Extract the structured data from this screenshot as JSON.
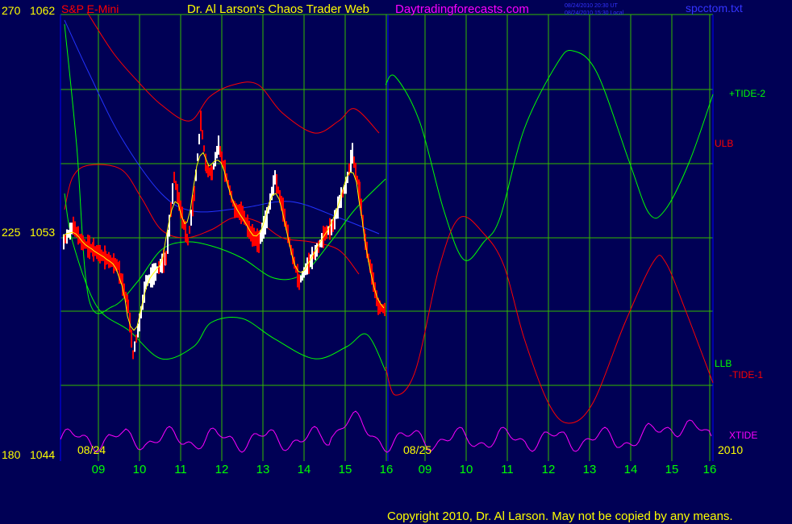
{
  "header": {
    "symbol": "S&P E-Mini",
    "title": "Dr. Al Larson's Chaos Trader Web",
    "website": "Daytradingforecasts.com",
    "stamp_ut": "08/24/2010 20:30 UT",
    "stamp_local": "08/24/2010 15:30 Local",
    "filename": "spcctom.txt"
  },
  "chart_data": {
    "type": "line",
    "left_axis": [
      {
        "left": "270",
        "right": "1062"
      },
      {
        "left": "225",
        "right": "1053"
      },
      {
        "left": "180",
        "right": "1044"
      }
    ],
    "ylim_price": [
      1044,
      1062
    ],
    "ylim_tide": [
      180,
      270
    ],
    "date_labels": [
      "08/24",
      "08/25",
      "2010"
    ],
    "x_ticks": [
      "09",
      "10",
      "11",
      "12",
      "13",
      "14",
      "15",
      "16",
      "09",
      "10",
      "11",
      "12",
      "13",
      "14",
      "15",
      "16"
    ],
    "series": [
      {
        "name": "+TIDE-2",
        "color": "#00ff00"
      },
      {
        "name": "ULB",
        "color": "#ff0000"
      },
      {
        "name": "LLB",
        "color": "#00ff00"
      },
      {
        "name": "-TIDE-1",
        "color": "#ff0000"
      },
      {
        "name": "XTIDE",
        "color": "#ff00ff"
      }
    ],
    "grid": true
  },
  "footer": {
    "copyright": "Copyright 2010, Dr. Al Larson. May not be copied by any means."
  },
  "colors": {
    "background": "#000055",
    "grid": "#33bb00",
    "frame": "#0000ff",
    "price_up": "#ffffff",
    "price_down": "#ff0000",
    "average": "#ffff00"
  }
}
